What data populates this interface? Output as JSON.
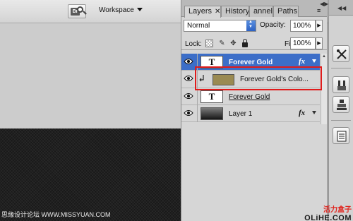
{
  "appbar": {
    "bridge_icon_label": "Br",
    "workspace_label": "Workspace"
  },
  "layers_panel": {
    "tabs": [
      {
        "label": "Layers",
        "active": true
      },
      {
        "label": "History",
        "active": false
      },
      {
        "label": "annels",
        "active": false
      },
      {
        "label": "Paths",
        "active": false
      }
    ],
    "close_glyph": "✕",
    "menu_glyph": "≡",
    "blend_mode": "Normal",
    "opacity_label": "Opacity:",
    "opacity_value": "100%",
    "lock_label": "Lock:",
    "fill_label": "Fill:",
    "fill_value": "100%",
    "layers": [
      {
        "name": "Forever Gold",
        "type": "text",
        "selected": true,
        "has_fx": true
      },
      {
        "name": "Forever Gold's Colo...",
        "type": "color-fill",
        "clipped": true,
        "highlighted": true
      },
      {
        "name": "Forever Gold",
        "type": "text",
        "underlined": true
      },
      {
        "name": "Layer 1",
        "type": "gradient",
        "has_fx": true
      }
    ],
    "fx_label": "fx",
    "text_thumb": "T"
  },
  "dock": {
    "tools": [
      "tool-presets-icon",
      "brush-icon",
      "clone-source-icon",
      "notes-icon"
    ]
  },
  "watermark": {
    "left": "思缘设计论坛 WWW.MISSYUAN.COM",
    "right_top": "活力盒子",
    "right_bottom": "OLiHE.COM"
  },
  "colors": {
    "selection": "#3c6ec8",
    "highlight_border": "#e01b1b",
    "color_fill_swatch": "#9a8a52"
  }
}
